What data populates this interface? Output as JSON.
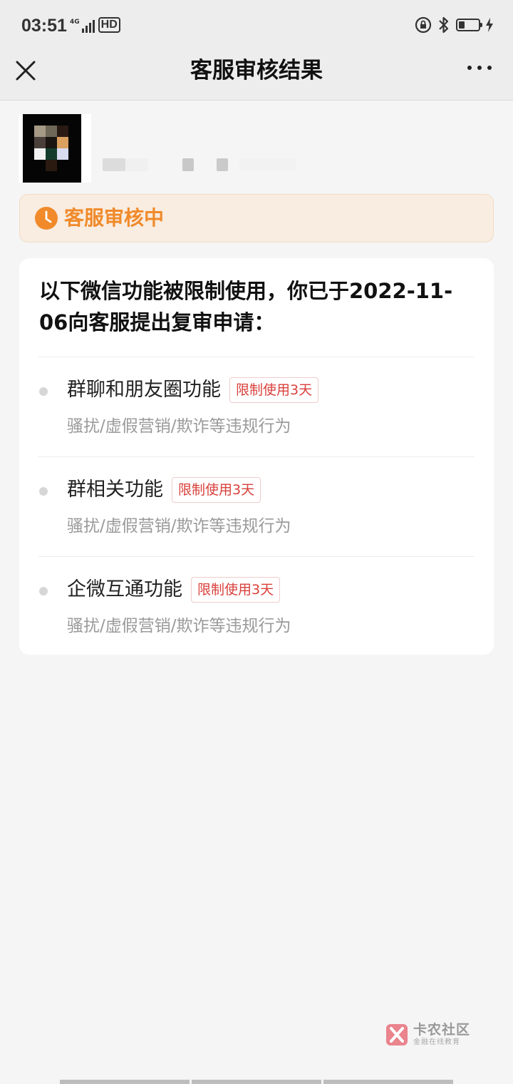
{
  "status_bar": {
    "time": "03:51",
    "network": "4G",
    "hd": "HD",
    "battery_level": 0.3
  },
  "nav": {
    "title": "客服审核结果"
  },
  "banner": {
    "status": "客服审核中",
    "color": "#f08a2a"
  },
  "card": {
    "heading": "以下微信功能被限制使用，你已于2022-11-06向客服提出复审申请：",
    "items": [
      {
        "name": "群聊和朋友圈功能",
        "tag": "限制使用3天",
        "reason": "骚扰/虚假营销/欺诈等违规行为"
      },
      {
        "name": "群相关功能",
        "tag": "限制使用3天",
        "reason": "骚扰/虚假营销/欺诈等违规行为"
      },
      {
        "name": "企微互通功能",
        "tag": "限制使用3天",
        "reason": "骚扰/虚假营销/欺诈等违规行为"
      }
    ]
  },
  "watermark": {
    "title": "卡农社区",
    "subtitle": "金融在线教育"
  },
  "colors": {
    "tag_red": "#d9403b",
    "banner_bg": "#f9ece0",
    "page_bg": "#f5f5f5"
  }
}
